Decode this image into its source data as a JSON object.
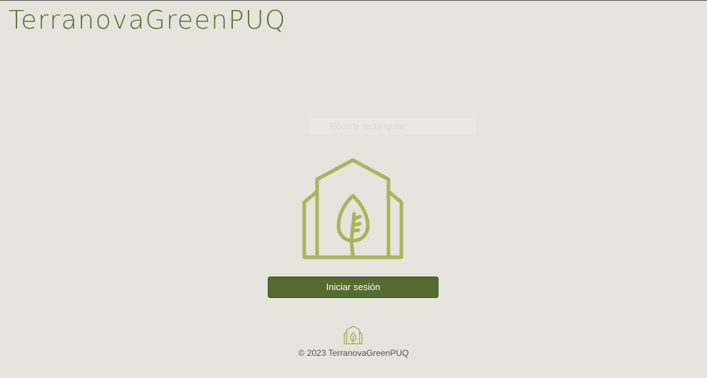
{
  "header": {
    "brand": "TerranovaGreenPUQ"
  },
  "main": {
    "faint_text": "Recorte rectangular",
    "logo_icon": "greenhouse-leaf-icon",
    "login_label": "Iniciar sesión"
  },
  "footer": {
    "logo_icon": "greenhouse-leaf-icon",
    "copyright": "© 2023 TerranovaGreenPUQ"
  },
  "colors": {
    "background": "#e5e5dd",
    "brand": "#556b2f",
    "logo": "#a9b55a",
    "button": "#556b2f",
    "button_text": "#ffffff"
  }
}
